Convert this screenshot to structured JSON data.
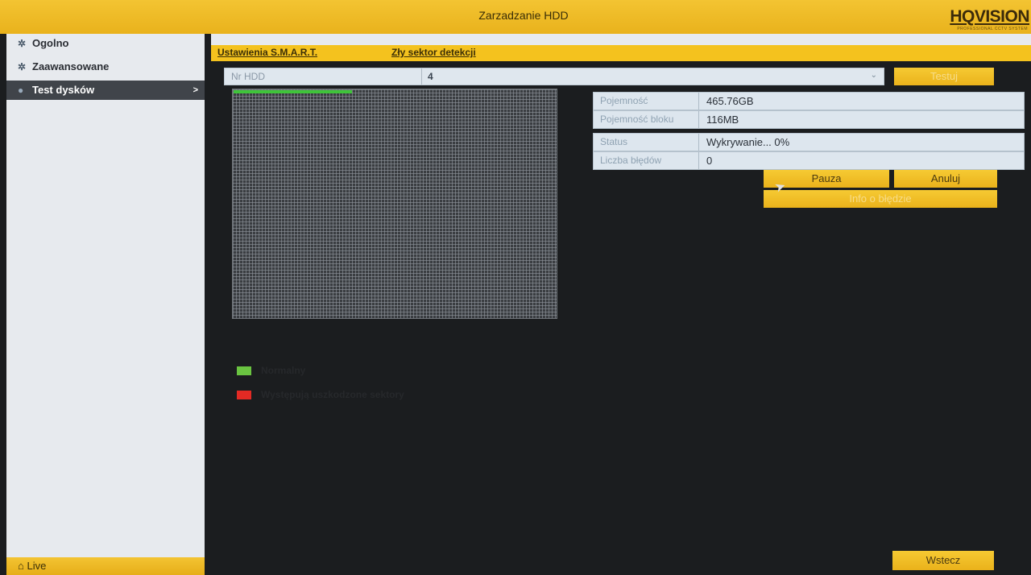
{
  "header": {
    "title": "Zarzadzanie HDD",
    "logo": "HQVISION",
    "logo_sub": "PROFESSIONAL CCTV SYSTEM"
  },
  "sidebar": {
    "items": [
      {
        "label": "Ogolno",
        "icon": "gear-icon"
      },
      {
        "label": "Zaawansowane",
        "icon": "gear-icon"
      },
      {
        "label": "Test dysków",
        "icon": "disk-icon",
        "active": true
      }
    ],
    "live_label": "Live"
  },
  "tabs": [
    {
      "label": "Ustawienia S.M.A.R.T."
    },
    {
      "label": "Zły sektor detekcji"
    }
  ],
  "hdd": {
    "label": "Nr HDD",
    "value": "4"
  },
  "buttons": {
    "test": "Testuj",
    "pause": "Pauza",
    "cancel": "Anuluj",
    "error_info": "Info o błędzie",
    "back": "Wstecz"
  },
  "info": {
    "capacity_label": "Pojemność",
    "capacity_value": "465.76GB",
    "block_label": "Pojemność bloku",
    "block_value": "116MB",
    "status_label": "Status",
    "status_value": "Wykrywanie... 0%",
    "errors_label": "Liczba błędów",
    "errors_value": "0"
  },
  "scan": {
    "progress_fraction": 0.37
  },
  "legend": [
    {
      "label": "Normalny",
      "color": "#6ac441"
    },
    {
      "label": "Występują uszkodzone sektory",
      "color": "#e42a24"
    }
  ],
  "colors": {
    "accent": "#f4c21e",
    "background": "#1b1d1f"
  }
}
